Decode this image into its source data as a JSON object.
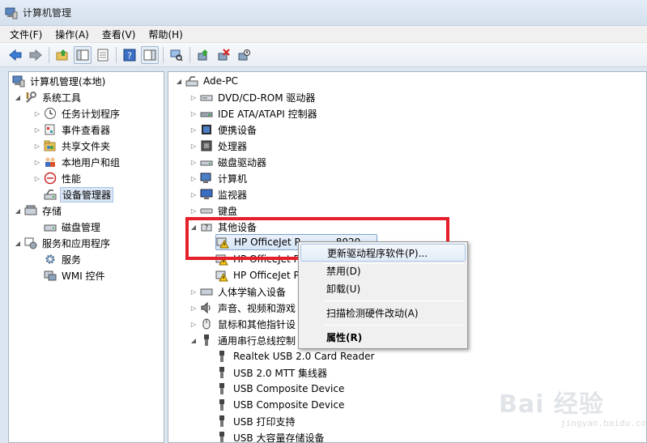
{
  "window": {
    "title": "计算机管理"
  },
  "menubar": {
    "items": [
      "文件(F)",
      "操作(A)",
      "查看(V)",
      "帮助(H)"
    ]
  },
  "left_tree": {
    "root": "计算机管理(本地)",
    "system_tools": "系统工具",
    "system_tools_children": [
      "任务计划程序",
      "事件查看器",
      "共享文件夹",
      "本地用户和组",
      "性能",
      "设备管理器"
    ],
    "storage": "存储",
    "storage_children": [
      "磁盘管理"
    ],
    "services_apps": "服务和应用程序",
    "services_apps_children": [
      "服务",
      "WMI 控件"
    ]
  },
  "device_tree": {
    "computer": "Ade-PC",
    "categories": [
      "DVD/CD-ROM 驱动器",
      "IDE ATA/ATAPI 控制器",
      "便携设备",
      "处理器",
      "磁盘驱动器",
      "计算机",
      "监视器",
      "键盘"
    ],
    "other_devices": "其他设备",
    "other_children": [
      "HP OfficeJet P",
      "HP OfficeJet P",
      "HP OfficeJet P"
    ],
    "other_child_tail": "8020 ...",
    "more_categories": [
      "人体学输入设备",
      "声音、视频和游戏",
      "鼠标和其他指针设",
      "通用串行总线控制"
    ],
    "usb_children": [
      "Realtek USB 2.0 Card Reader",
      "USB 2.0 MTT 集线器",
      "USB Composite Device",
      "USB Composite Device",
      "USB 打印支持",
      "USB 大容量存储设备"
    ]
  },
  "context_menu": {
    "update_driver": "更新驱动程序软件(P)...",
    "disable": "禁用(D)",
    "uninstall": "卸载(U)",
    "scan": "扫描检测硬件改动(A)",
    "properties": "属性(R)"
  },
  "watermark": {
    "main": "Bai 经验",
    "sub": "jingyan.baidu.com"
  },
  "colors": {
    "annotation_red": "#e5202a",
    "selection": "#dbe6f4"
  }
}
